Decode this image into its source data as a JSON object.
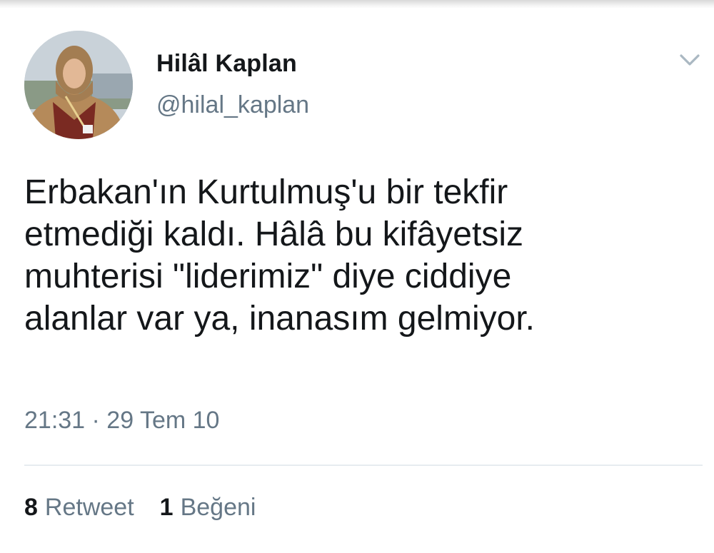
{
  "author": {
    "display_name": "Hilâl Kaplan",
    "handle": "@hilal_kaplan"
  },
  "tweet": {
    "text": "Erbakan'ın Kurtulmuş'u bir tekfir\netmediği kaldı. Hâlâ bu kifâyetsiz\nmuhterisi \"liderimiz\" diye ciddiye\nalanlar var ya, inanasım gelmiyor.",
    "timestamp": "21:31 · 29 Tem 10"
  },
  "stats": {
    "retweet_count": "8",
    "retweet_label": "Retweet",
    "like_count": "1",
    "like_label": "Beğeni"
  },
  "icons": {
    "menu": "chevron-down-icon",
    "avatar": "profile-photo"
  },
  "colors": {
    "text_primary": "#14171a",
    "text_secondary": "#657786",
    "divider": "#e6ecf0",
    "chevron": "#aab8c2"
  }
}
